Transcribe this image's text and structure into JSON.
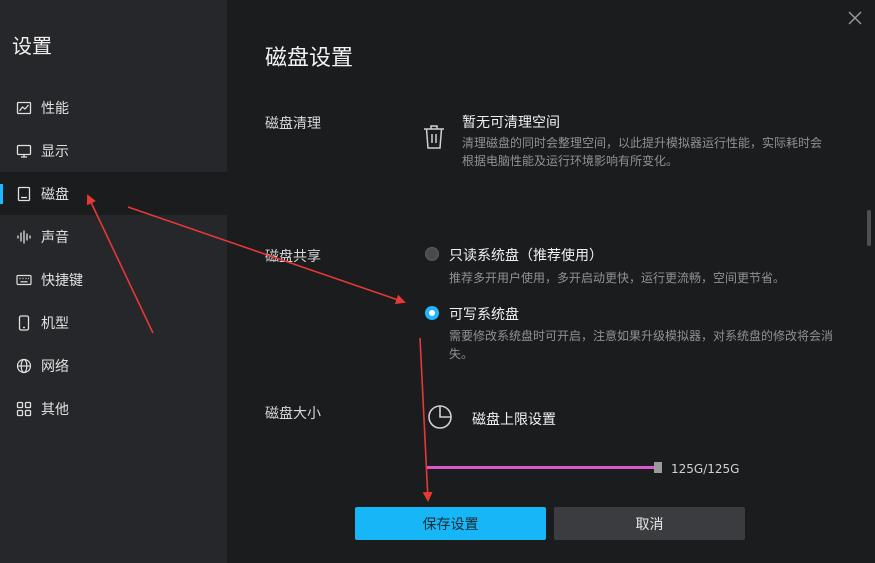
{
  "sidebar": {
    "title": "设置",
    "items": [
      {
        "label": "性能",
        "icon": "chart-icon",
        "active": false
      },
      {
        "label": "显示",
        "icon": "monitor-icon",
        "active": false
      },
      {
        "label": "磁盘",
        "icon": "disk-icon",
        "active": true
      },
      {
        "label": "声音",
        "icon": "sound-wave-icon",
        "active": false
      },
      {
        "label": "快捷键",
        "icon": "keyboard-icon",
        "active": false
      },
      {
        "label": "机型",
        "icon": "phone-icon",
        "active": false
      },
      {
        "label": "网络",
        "icon": "globe-icon",
        "active": false
      },
      {
        "label": "其他",
        "icon": "grid-icon",
        "active": false
      }
    ]
  },
  "main": {
    "title": "磁盘设置",
    "cleanup": {
      "label": "磁盘清理",
      "title": "暂无可清理空间",
      "description": "清理磁盘的同时会整理空间，以此提升模拟器运行性能，实际耗时会根据电脑性能及运行环境影响有所变化。"
    },
    "share": {
      "label": "磁盘共享",
      "options": [
        {
          "label": "只读系统盘（推荐使用）",
          "description": "推荐多开用户使用，多开启动更快，运行更流畅，空间更节省。",
          "selected": false
        },
        {
          "label": "可写系统盘",
          "description": "需要修改系统盘时可开启，注意如果升级模拟器，对系统盘的修改将会消失。",
          "selected": true
        }
      ]
    },
    "size": {
      "label": "磁盘大小",
      "title": "磁盘上限设置",
      "value_text": "125G/125G",
      "fill_fraction": 1.0
    }
  },
  "buttons": {
    "save": "保存设置",
    "cancel": "取消"
  },
  "colors": {
    "accent": "#1fb5ff",
    "slider": "#d958d0",
    "annotation": "#e53935"
  }
}
